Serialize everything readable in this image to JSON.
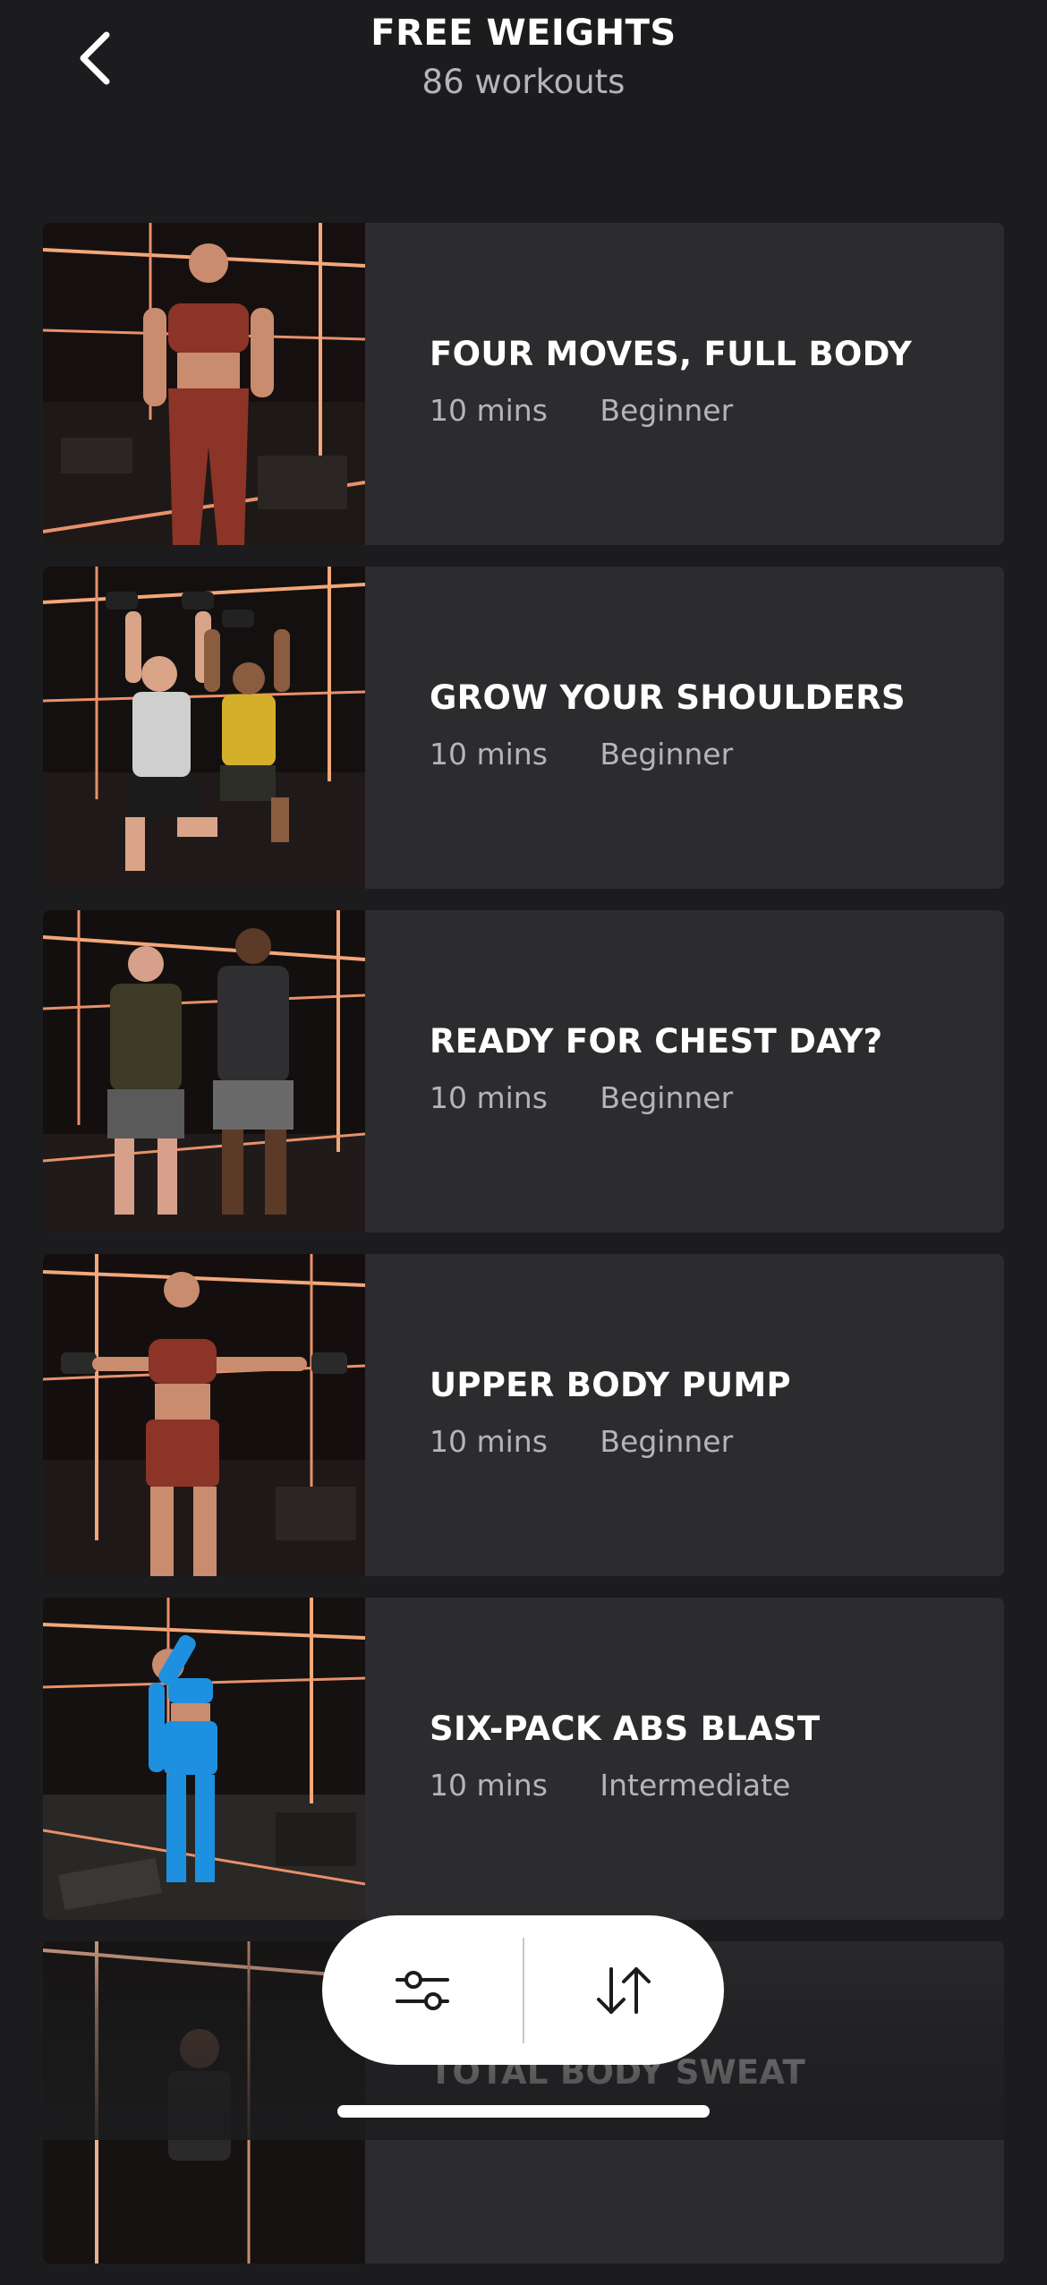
{
  "header": {
    "back_icon": "chevron-left-icon",
    "title": "FREE WEIGHTS",
    "subtitle": "86 workouts"
  },
  "workouts": [
    {
      "title": "FOUR MOVES, FULL BODY",
      "duration": "10 mins",
      "level": "Beginner"
    },
    {
      "title": "GROW YOUR SHOULDERS",
      "duration": "10 mins",
      "level": "Beginner"
    },
    {
      "title": "READY FOR CHEST DAY?",
      "duration": "10 mins",
      "level": "Beginner"
    },
    {
      "title": "UPPER BODY PUMP",
      "duration": "10 mins",
      "level": "Beginner"
    },
    {
      "title": "SIX-PACK ABS BLAST",
      "duration": "10 mins",
      "level": "Intermediate"
    },
    {
      "title": "TOTAL BODY SWEAT",
      "duration": "",
      "level": ""
    }
  ],
  "floating_bar": {
    "filter_icon": "sliders-filter-icon",
    "sort_icon": "sort-arrows-icon"
  },
  "colors": {
    "background": "#1c1c1e",
    "card": "#2c2c2e",
    "text_primary": "#ffffff",
    "text_secondary": "#b5b5b8",
    "accent_light": "#f0a070"
  }
}
